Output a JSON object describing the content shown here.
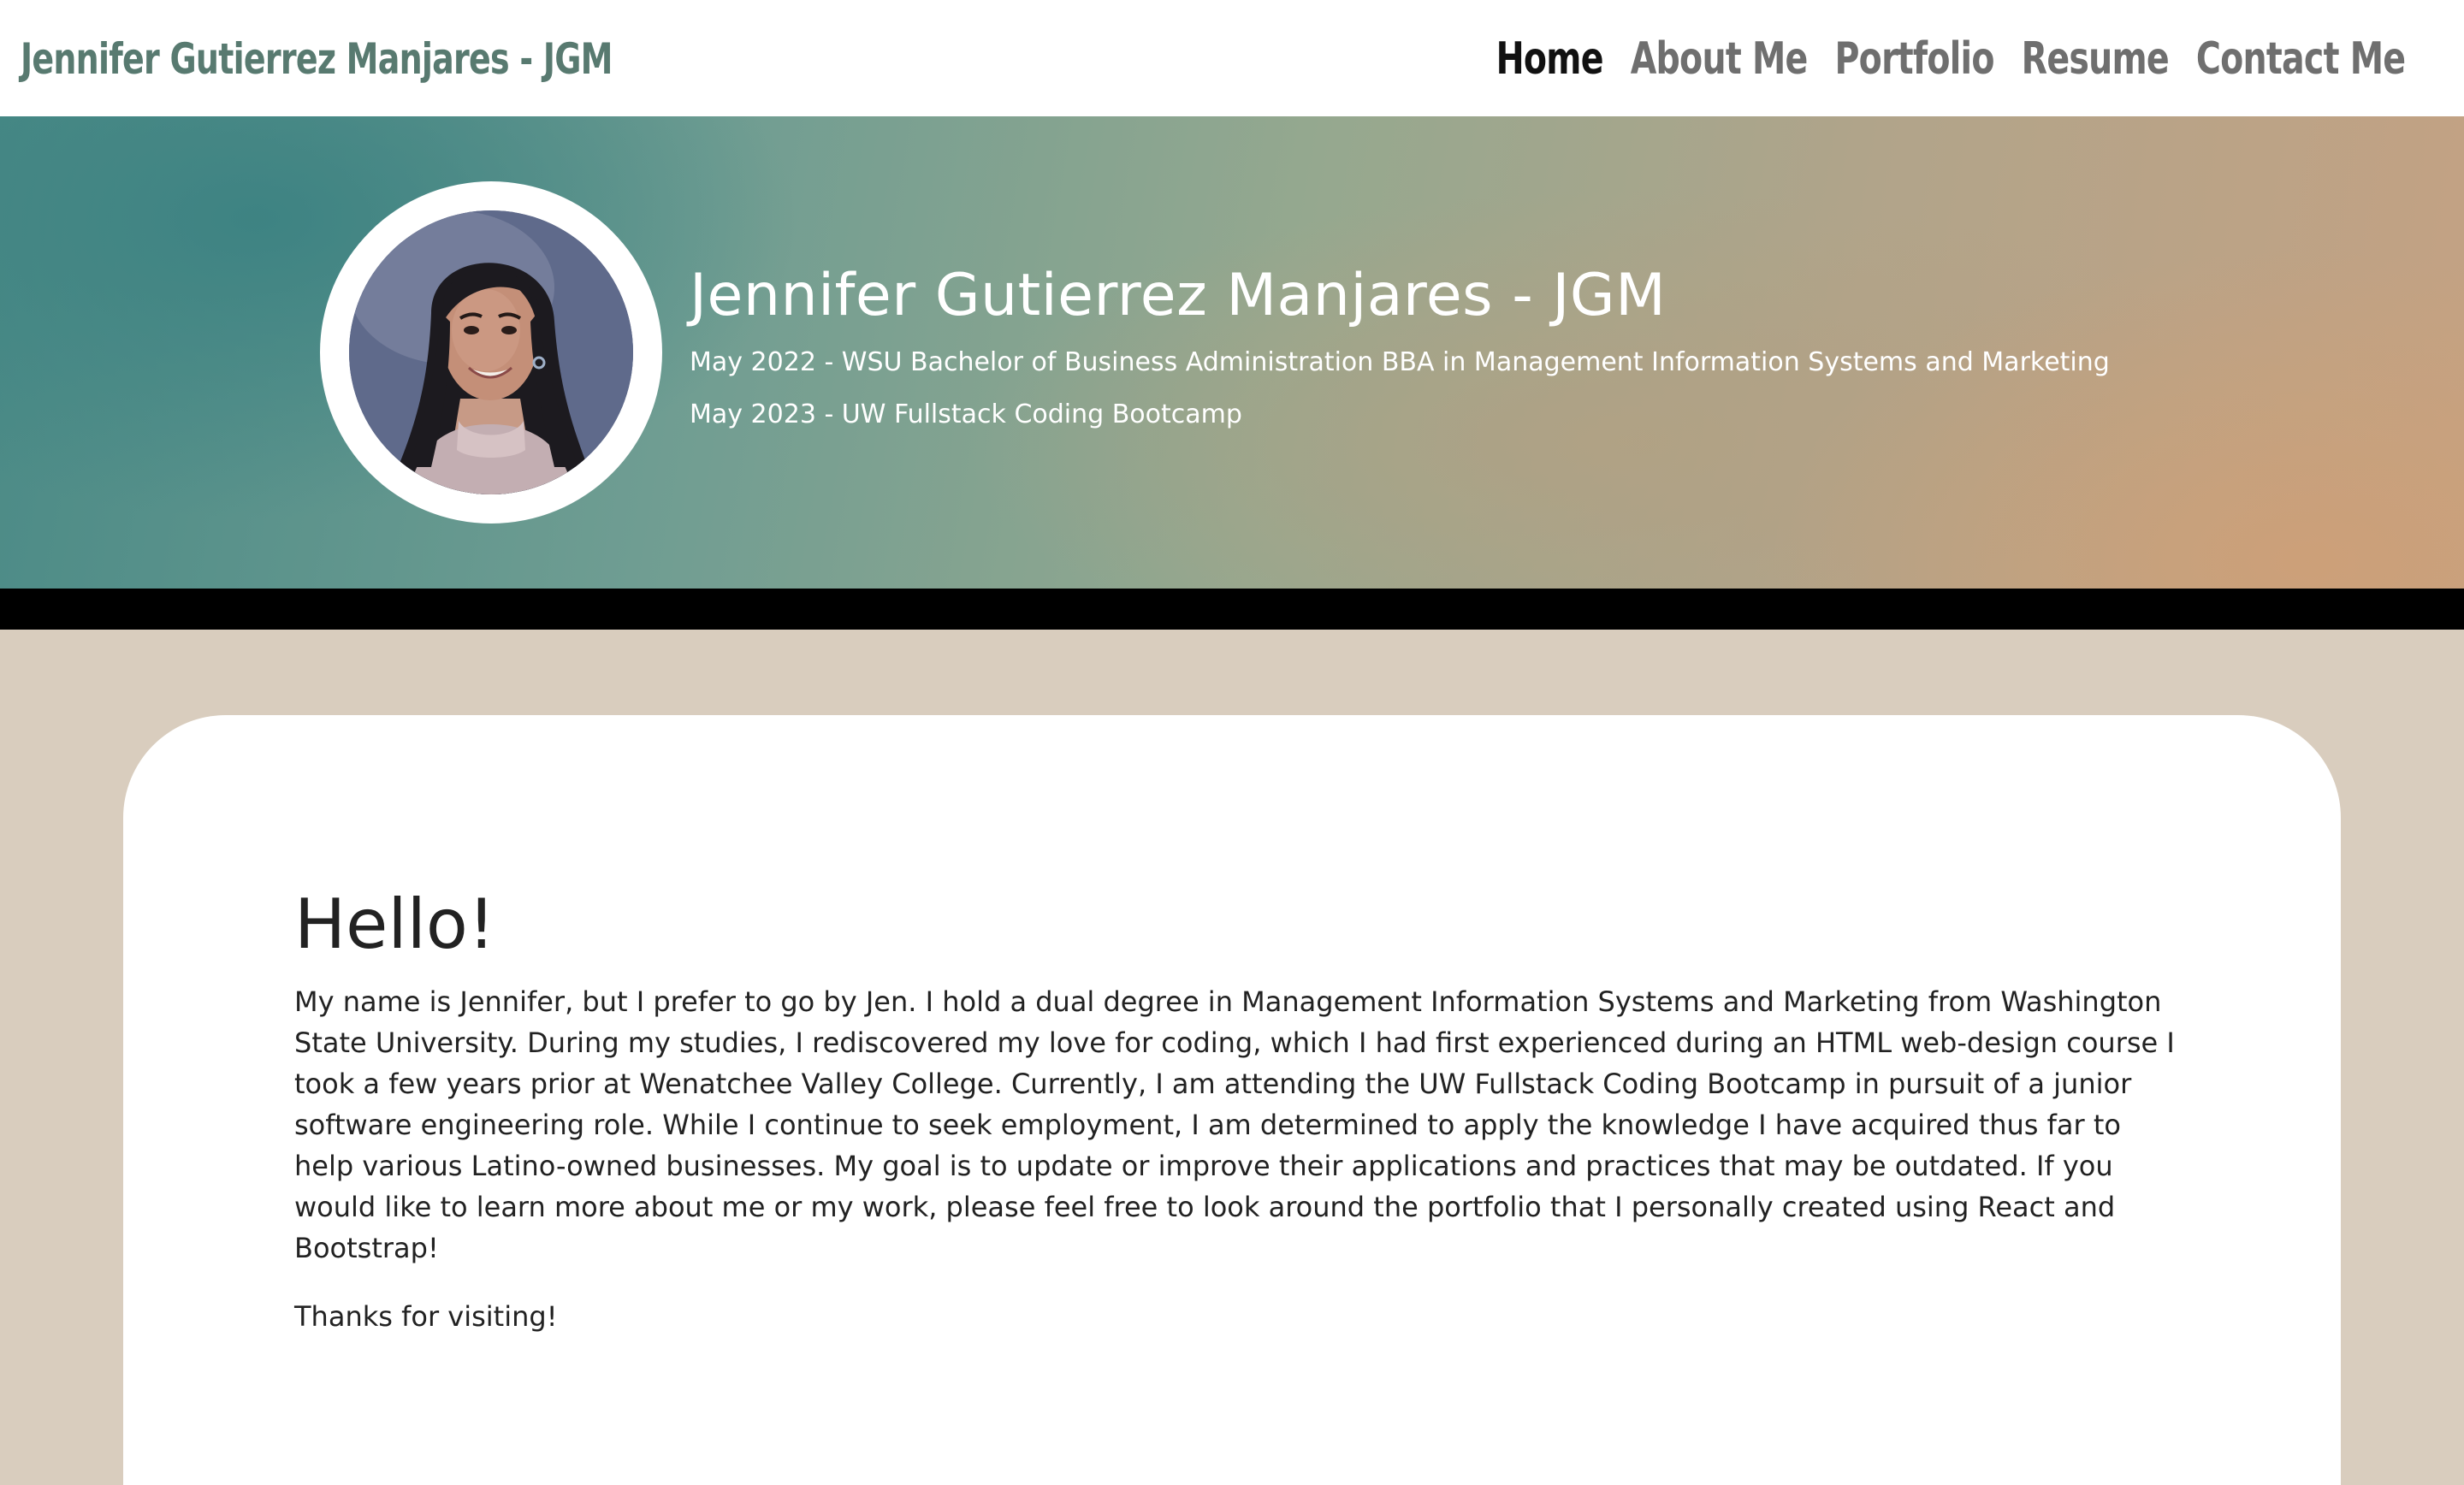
{
  "navbar": {
    "brand": "Jennifer Gutierrez Manjares - JGM",
    "links": [
      {
        "label": "Home",
        "active": true
      },
      {
        "label": "About Me",
        "active": false
      },
      {
        "label": "Portfolio",
        "active": false
      },
      {
        "label": "Resume",
        "active": false
      },
      {
        "label": "Contact Me",
        "active": false
      }
    ]
  },
  "hero": {
    "title": "Jennifer Gutierrez Manjares - JGM",
    "line1": "May 2022 - WSU Bachelor of Business Administration BBA in Management Information Systems and Marketing",
    "line2": "May 2023 - UW Fullstack Coding Bootcamp"
  },
  "main": {
    "heading": "Hello!",
    "body": "My name is Jennifer, but I prefer to go by Jen. I hold a dual degree in Management Information Systems and Marketing from Washington State University. During my studies, I rediscovered my love for coding, which I had first experienced during an HTML web-design course I took a few years prior at Wenatchee Valley College. Currently, I am attending the UW Fullstack Coding Bootcamp in pursuit of a junior software engineering role. While I continue to seek employment, I am determined to apply the knowledge I have acquired thus far to help various Latino-owned businesses. My goal is to update or improve their applications and practices that may be outdated. If you would like to learn more about me or my work, please feel free to look around the portfolio that I personally created using React and Bootstrap!",
    "thanks": "Thanks for visiting!"
  },
  "colors": {
    "brand": "#587a70",
    "nav_active": "#111111",
    "nav_inactive": "#6f6f6f",
    "page_background": "#d9cdbe",
    "card_background": "#ffffff",
    "hero_bar": "#000000"
  }
}
